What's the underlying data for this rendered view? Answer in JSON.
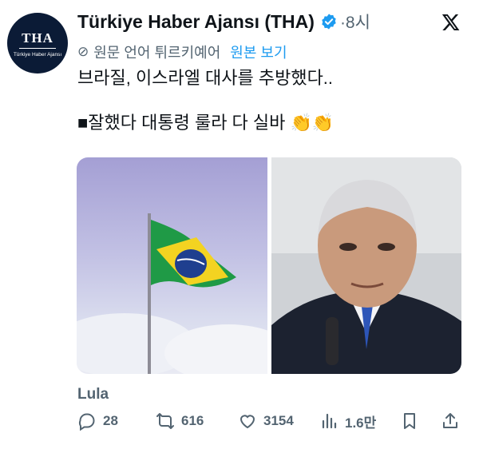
{
  "account": {
    "name": "Türkiye Haber Ajansı (THA)",
    "time": "·8시",
    "avatar_logo": "THA",
    "avatar_sub": "Türkiye Haber Ajansı"
  },
  "translation": {
    "note": "원문 언어 튀르키예어",
    "link": "원본 보기"
  },
  "tweet": {
    "line1": "브라질, 이스라엘 대사를 추방했다..",
    "line2": "■잘했다 대통령 룰라 다 실바 👏👏"
  },
  "media": {
    "left_icon": "brazil-flag-image",
    "right_icon": "portrait-photo"
  },
  "caption": "Lula",
  "stats": {
    "replies": "28",
    "reposts": "616",
    "likes": "3154",
    "views": "1.6만"
  },
  "colors": {
    "accent": "#1d9bf0",
    "muted": "#536471",
    "text": "#0f1419",
    "avatar_bg": "#0b1b36"
  }
}
